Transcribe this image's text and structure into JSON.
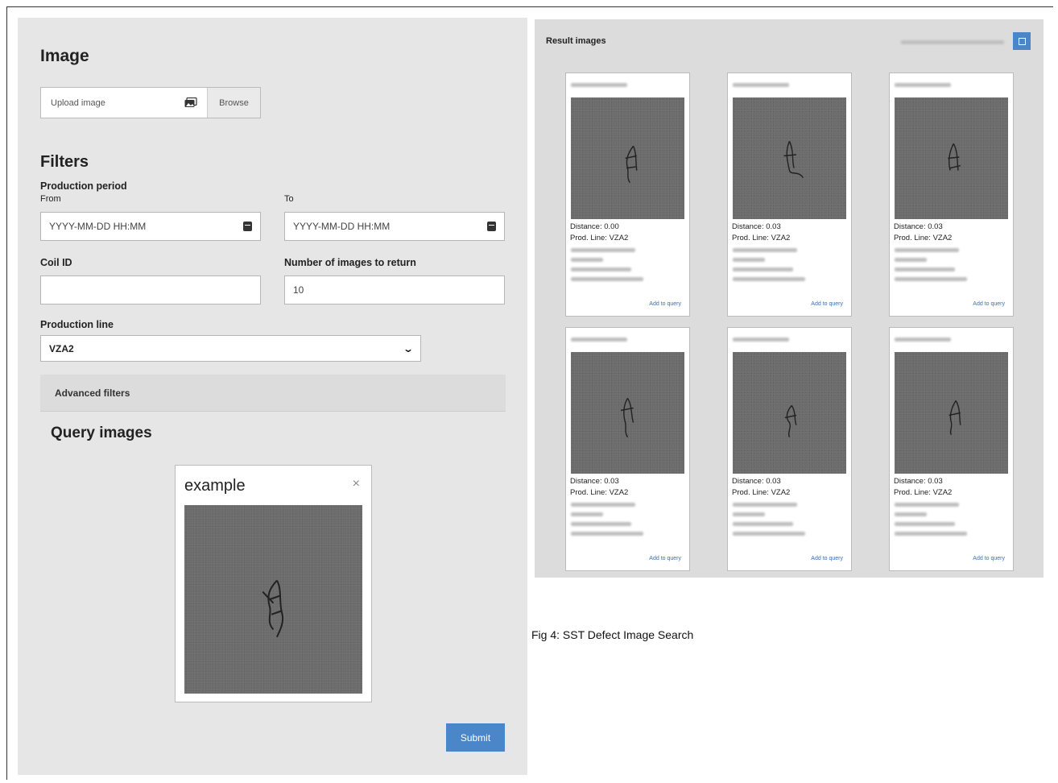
{
  "left": {
    "image_heading": "Image",
    "upload_placeholder": "Upload image",
    "browse_label": "Browse",
    "filters_heading": "Filters",
    "production_period_label": "Production period",
    "from_label": "From",
    "to_label": "To",
    "from_placeholder": "YYYY-MM-DD HH:MM",
    "to_placeholder": "YYYY-MM-DD HH:MM",
    "coil_id_label": "Coil ID",
    "coil_id_value": "",
    "num_images_label": "Number of images to return",
    "num_images_value": "10",
    "production_line_label": "Production line",
    "production_line_value": "VZA2",
    "advanced_filters_label": "Advanced filters",
    "query_images_heading": "Query images",
    "query_card_title": "example",
    "close_glyph": "×",
    "submit_label": "Submit"
  },
  "right": {
    "title": "Result images",
    "results": [
      {
        "distance": "Distance: 0.00",
        "line": "Prod. Line: VZA2",
        "add": "Add to query"
      },
      {
        "distance": "Distance: 0.03",
        "line": "Prod. Line: VZA2",
        "add": "Add to query"
      },
      {
        "distance": "Distance: 0.03",
        "line": "Prod. Line: VZA2",
        "add": "Add to query"
      },
      {
        "distance": "Distance: 0.03",
        "line": "Prod. Line: VZA2",
        "add": "Add to query"
      },
      {
        "distance": "Distance: 0.03",
        "line": "Prod. Line: VZA2",
        "add": "Add to query"
      },
      {
        "distance": "Distance: 0.03",
        "line": "Prod. Line: VZA2",
        "add": "Add to query"
      }
    ]
  },
  "caption": "Fig 4: SST Defect Image Search",
  "colors": {
    "panel_bg": "#e6e6e6",
    "results_bg": "#dcdcdc",
    "accent": "#4a86c8",
    "defect_gray": "#6c6c6c"
  },
  "icons": {
    "upload": "image-upload-icon",
    "calendar": "calendar-icon",
    "dropdown": "chevron-down-icon",
    "close": "close-icon",
    "view_toggle": "grid-view-icon"
  }
}
